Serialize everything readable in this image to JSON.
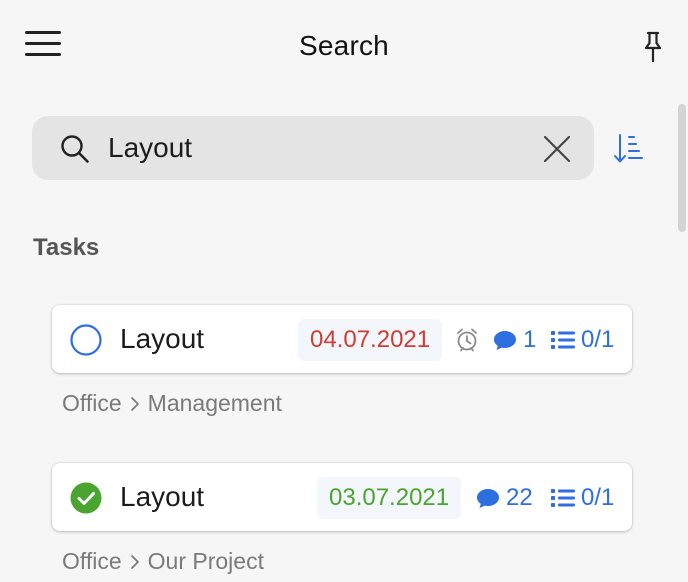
{
  "header": {
    "title": "Search"
  },
  "search": {
    "value": "Layout"
  },
  "section": {
    "title": "Tasks"
  },
  "tasks": [
    {
      "title": "Layout",
      "completed": false,
      "date": "04.07.2021",
      "date_color": "#d23c32",
      "has_reminder": true,
      "comments": "1",
      "checklist": "0/1",
      "breadcrumb": [
        "Office",
        "Management"
      ]
    },
    {
      "title": "Layout",
      "completed": true,
      "date": "03.07.2021",
      "date_color": "#4aa530",
      "has_reminder": false,
      "comments": "22",
      "checklist": "0/1",
      "breadcrumb": [
        "Office",
        "Our Project"
      ]
    }
  ],
  "colors": {
    "accent": "#2d6fe0",
    "overdue": "#d23c32",
    "done": "#4aa530",
    "background": "#f6f6f6"
  },
  "icons": {
    "menu": "hamburger-menu-icon",
    "pin": "pin-icon",
    "search": "search-icon",
    "clear": "close-icon",
    "sort": "sort-icon",
    "reminder": "alarm-clock-icon",
    "comments": "comment-icon",
    "checklist": "checklist-icon"
  }
}
